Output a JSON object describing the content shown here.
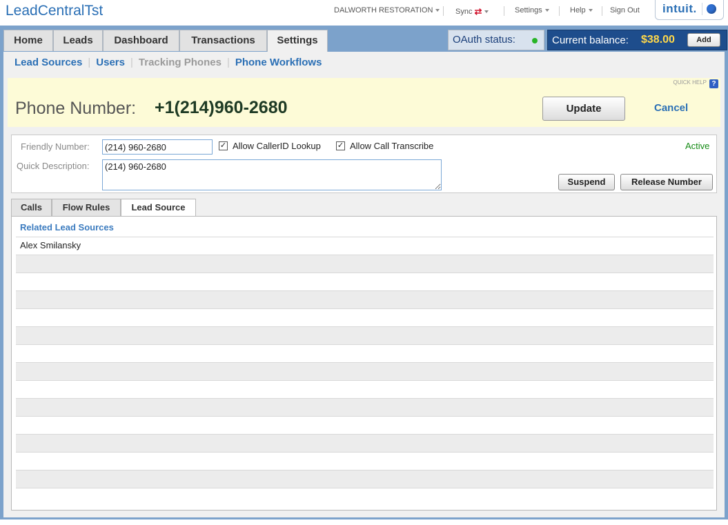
{
  "app": {
    "title": "LeadCentralTst"
  },
  "topmenu": {
    "company": "DALWORTH RESTORATION",
    "sync": "Sync",
    "settings": "Settings",
    "help": "Help",
    "sign_out": "Sign Out",
    "brand": "intuit."
  },
  "main_tabs": [
    "Home",
    "Leads",
    "Dashboard",
    "Transactions",
    "Settings"
  ],
  "active_tab": "Settings",
  "oauth": {
    "label": "OAuth status:"
  },
  "balance": {
    "label": "Current balance:",
    "value": "$38.00",
    "add_label": "Add"
  },
  "subnav": [
    "Lead Sources",
    "Users",
    "Tracking Phones",
    "Phone Workflows"
  ],
  "header": {
    "quick_help": "QUICK HELP",
    "quick_help_icon": "?",
    "phone_label": "Phone Number:",
    "phone_value": "+1(214)960-2680",
    "update_label": "Update",
    "cancel_label": "Cancel"
  },
  "details": {
    "friendly_label": "Friendly Number:",
    "friendly_value": "(214) 960-2680",
    "desc_label": "Quick Description:",
    "desc_value": "(214) 960-2680",
    "callerid_label": "Allow CallerID Lookup",
    "callerid_checked": true,
    "transcribe_label": "Allow Call Transcribe",
    "transcribe_checked": true,
    "status": "Active",
    "suspend_label": "Suspend",
    "release_label": "Release Number"
  },
  "panel_tabs": [
    "Calls",
    "Flow Rules",
    "Lead Source"
  ],
  "active_panel_tab": "Lead Source",
  "panel": {
    "heading": "Related Lead Sources",
    "rows": [
      "Alex Smilansky",
      "",
      "",
      "",
      "",
      "",
      "",
      "",
      "",
      "",
      "",
      "",
      "",
      "",
      ""
    ]
  },
  "colors": {
    "accent": "#2a6fb5",
    "frame": "#7ca2cb",
    "balance_bg": "#1e4d8c",
    "balance_value": "#ffd84a",
    "active_status": "#138a13"
  }
}
